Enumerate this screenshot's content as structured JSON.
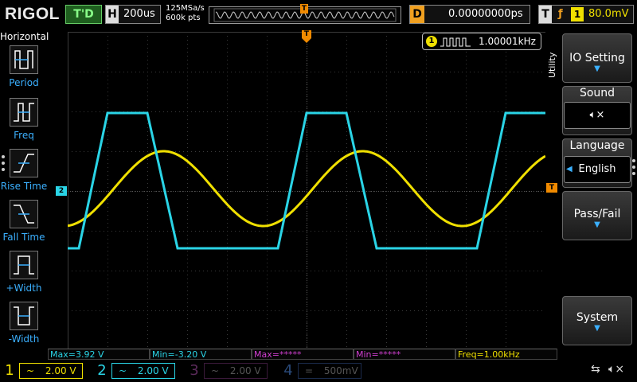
{
  "header": {
    "logo": "RIGOL",
    "run_state": "T'D",
    "horizontal_label": "H",
    "timebase": "200us",
    "sample_rate": "125MSa/s",
    "memory_depth": "600k pts",
    "trigger_marker": "T",
    "delay_label": "D",
    "delay_value": "0.00000000ps",
    "trigger_label": "T",
    "trigger_source": "1",
    "trigger_level": "80.0mV"
  },
  "left_panel": {
    "title": "Horizontal",
    "items": [
      {
        "label": "Period",
        "icon": "period-icon"
      },
      {
        "label": "Freq",
        "icon": "freq-icon"
      },
      {
        "label": "Rise Time",
        "icon": "rise-time-icon"
      },
      {
        "label": "Fall Time",
        "icon": "fall-time-icon"
      },
      {
        "label": "+Width",
        "icon": "positive-width-icon"
      },
      {
        "label": "-Width",
        "icon": "negative-width-icon"
      }
    ]
  },
  "display": {
    "freq_counter": {
      "channel": "1",
      "value": "1.00001kHz"
    },
    "ch2_marker": "2",
    "trigger_level_marker": "T",
    "trigger_pos_marker": "T",
    "colors": {
      "ch1": "#f0e000",
      "ch2": "#2ad4e6",
      "ch3": "#d03fd0",
      "ch4": "#3b78d8",
      "trigger": "#f08a00",
      "grid": "#3a3a3a"
    }
  },
  "right_panel": {
    "tab_label": "Utility",
    "io_setting": "IO Setting",
    "sound": "Sound",
    "sound_icon": "speaker-muted-icon",
    "language": "Language",
    "language_value": "English",
    "pass_fail": "Pass/Fail",
    "system": "System"
  },
  "measurements": [
    {
      "text": "Max=3.92 V",
      "color": "#2ad4e6"
    },
    {
      "text": "Min=-3.20 V",
      "color": "#2ad4e6"
    },
    {
      "text": "Max=*****",
      "color": "#d03fd0"
    },
    {
      "text": "Min=*****",
      "color": "#d03fd0"
    },
    {
      "text": "Freq=1.00kHz",
      "color": "#f0e000"
    }
  ],
  "channels": [
    {
      "num": "1",
      "coupling": "~",
      "scale": "2.00 V",
      "color": "#f0e000"
    },
    {
      "num": "2",
      "coupling": "~",
      "scale": "2.00 V",
      "color": "#2ad4e6"
    },
    {
      "num": "3",
      "coupling": "~",
      "scale": "2.00 V",
      "color": "#9a3a9a"
    },
    {
      "num": "4",
      "coupling": "=",
      "scale": "500mV",
      "color": "#3b78d8"
    }
  ],
  "status_icons": [
    "usb-icon",
    "speaker-muted-icon"
  ]
}
